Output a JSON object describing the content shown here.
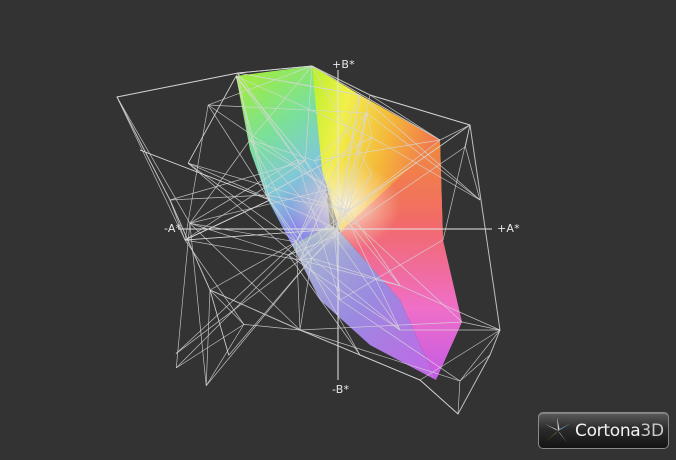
{
  "viewer": {
    "background_color": "#333333",
    "wireframe_color": "#d8d8d8"
  },
  "axes": {
    "plus_b": "+B*",
    "minus_b": "-B*",
    "plus_a": "+A*",
    "minus_a": "-A*"
  },
  "logo": {
    "name": "Cortona",
    "suffix": "3D",
    "icon": "cortona-star-icon"
  }
}
